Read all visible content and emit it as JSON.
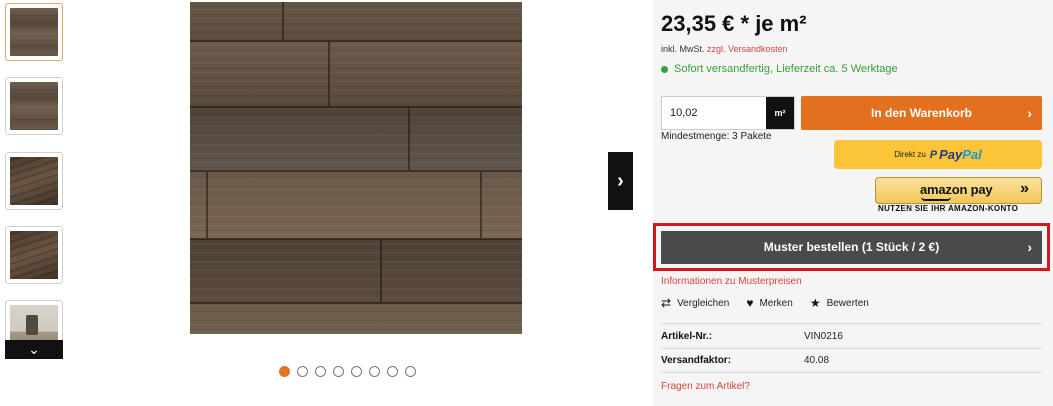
{
  "gallery": {
    "thumbnails": [
      {
        "icon": "wood-floor-thumbnail"
      },
      {
        "icon": "wood-floor-thumbnail"
      },
      {
        "icon": "wood-plank-closeup-thumbnail"
      },
      {
        "icon": "wood-plank-closeup-thumbnail"
      },
      {
        "icon": "room-scene-thumbnail"
      }
    ],
    "scroll_down_icon": "⌄",
    "next_icon": "›",
    "dots_total": 8,
    "active_dot": 1
  },
  "product": {
    "price": "23,35 € * je m²",
    "tax_prefix": "inkl. MwSt.",
    "shipping_link": "zzgl. Versandkosten",
    "availability": "Sofort versandfertig, Lieferzeit ca. 5 Werktage",
    "quantity_value": "10,02",
    "quantity_unit": "m²",
    "add_to_cart": "In den Warenkorb",
    "min_quantity": "Mindestmenge: 3 Pakete",
    "paypal_prefix": "Direkt zu",
    "paypal_brand_1": "Pay",
    "paypal_brand_2": "Pal",
    "amazon_logo": "amazon pay",
    "amazon_caption": "NUTZEN SIE IHR AMAZON-KONTO",
    "order_sample": "Muster bestellen (1 Stück / 2 €)",
    "sample_info": "Informationen zu Musterpreisen",
    "actions": [
      {
        "icon": "compare-icon",
        "label": "Vergleichen"
      },
      {
        "icon": "heart-icon",
        "label": "Merken"
      },
      {
        "icon": "star-icon",
        "label": "Bewerten"
      }
    ],
    "attributes": [
      {
        "label": "Artikel-Nr.:",
        "value": "VIN0216"
      },
      {
        "label": "Versandfaktor:",
        "value": "40.08"
      }
    ],
    "ask_question": "Fragen zum Artikel?"
  },
  "colors": {
    "accent_orange": "#e3701f",
    "stock_green": "#3b9c3b",
    "highlight_red": "#d3161e",
    "link_red": "#d7453c",
    "paypal_yellow": "#fcc439"
  }
}
